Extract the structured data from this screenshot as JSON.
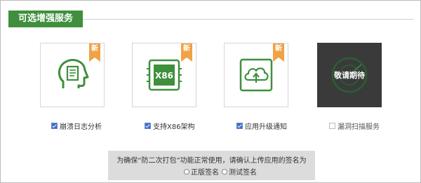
{
  "section": {
    "title": "可选增强服务"
  },
  "cards": [
    {
      "label": "崩溃日志分析",
      "badge": "新",
      "icon": "head-document-icon",
      "checked": true
    },
    {
      "label": "支持X86架构",
      "badge": "新",
      "icon": "x86-chip-icon",
      "checked": true,
      "chip_text": "X86"
    },
    {
      "label": "应用升级通知",
      "badge": "新",
      "icon": "cloud-upload-icon",
      "checked": true
    },
    {
      "label": "漏洞扫描服务",
      "overlay": "敬请期待",
      "icon": "radar-icon",
      "checked": false
    }
  ],
  "notice": {
    "message": "为确保“防二次打包”功能正常使用，请确认上传应用的签名为",
    "options": [
      "正版签名",
      "测试签名"
    ]
  },
  "colors": {
    "accent": "#3f8f3d",
    "badge": "#f0a245"
  }
}
